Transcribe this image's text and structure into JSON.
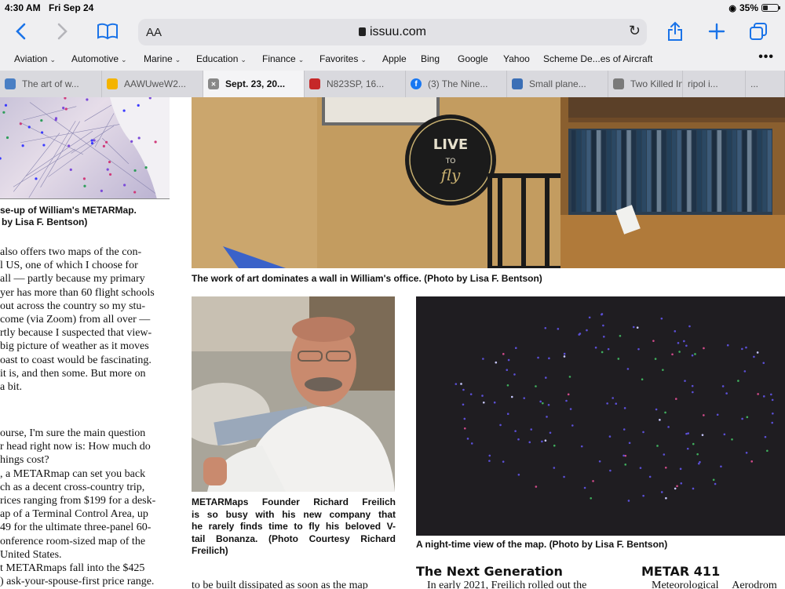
{
  "status_bar": {
    "time": "4:30 AM",
    "date": "Fri Sep 24",
    "battery": "35%"
  },
  "toolbar": {
    "aa_label": "AA",
    "url": "issuu.com"
  },
  "bookmarks": [
    {
      "label": "Aviation",
      "menu": true
    },
    {
      "label": "Automotive",
      "menu": true
    },
    {
      "label": "Marine",
      "menu": true
    },
    {
      "label": "Education",
      "menu": true
    },
    {
      "label": "Finance",
      "menu": true
    },
    {
      "label": "Favorites",
      "menu": true
    },
    {
      "label": "Apple",
      "menu": false
    },
    {
      "label": "Bing",
      "menu": false
    },
    {
      "label": "Google",
      "menu": false
    },
    {
      "label": "Yahoo",
      "menu": false
    },
    {
      "label": "Scheme De...es of Aircraft",
      "menu": false
    }
  ],
  "tabs": [
    {
      "label": "The art of w...",
      "icon": "x-icon",
      "color": "#4a7fc4"
    },
    {
      "label": "AAWUweW2...",
      "icon": "google-drive-icon",
      "color": "#f4b400"
    },
    {
      "label": "Sept. 23, 20...",
      "icon": "close-icon",
      "color": "#888888",
      "active": true
    },
    {
      "label": "N823SP, 16...",
      "icon": "asn-icon",
      "color": "#c62828"
    },
    {
      "label": "(3) The Nine...",
      "icon": "facebook-icon",
      "color": "#1877f2"
    },
    {
      "label": "Small plane...",
      "icon": "site-icon",
      "color": "#3b6fb6"
    },
    {
      "label": "Two Killed In...",
      "icon": "site-icon",
      "color": "#7a7a7a"
    },
    {
      "label": "ripol i...",
      "icon": "",
      "color": "#d9d9de"
    },
    {
      "label": "...",
      "icon": "",
      "color": "#d9d9de"
    }
  ],
  "article": {
    "caption_map": [
      "se-up of William's METARMap.",
      "by Lisa F. Bentson)"
    ],
    "col1_para1": [
      "also offers two maps of the con-",
      "l US, one of which I choose for",
      "all — partly because my primary",
      "yer has more than 60 flight schools",
      "out across the country so my stu-",
      "come (via Zoom) from all over —",
      "rtly because I suspected that view-",
      "big picture of weather as it moves",
      "oast to coast would be fascinating.",
      "it is, and then some. But more on",
      "a bit."
    ],
    "col1_para2": [
      "ourse, I'm sure the main question",
      "r head right now is: How much do",
      "hings cost?",
      ", a METARmap can set you back",
      "ch as a decent cross-country trip,",
      "rices ranging from $199 for a desk-",
      "ap of a Terminal Control Area, up",
      "49 for the ultimate three-panel 60-",
      "onference room-sized map of the",
      "United States.",
      "t METARmaps fall into the $425",
      ") ask-your-spouse-first price range."
    ],
    "caption_office": "The work of art dominates a wall in William's office. (Photo by Lisa F. Bentson)",
    "caption_founder": [
      "METARMaps Founder Richard Freilich",
      "is so busy with his new company that",
      "he rarely finds time to fly his beloved V-",
      "tail Bonanza. (Photo Courtesy Richard",
      "Freilich)"
    ],
    "caption_night": "A night-time view of the map. (Photo by Lisa F. Bentson)",
    "heading_next": "The Next Generation",
    "heading_metar": "METAR 411",
    "bottom_col2": "to be built dissipated as soon as the map",
    "bottom_col3": "In early 2021, Freilich rolled out the",
    "bottom_col4": "Meteorological Aerodrom",
    "sign_text": [
      "LIVE",
      "TO",
      "fly"
    ]
  }
}
